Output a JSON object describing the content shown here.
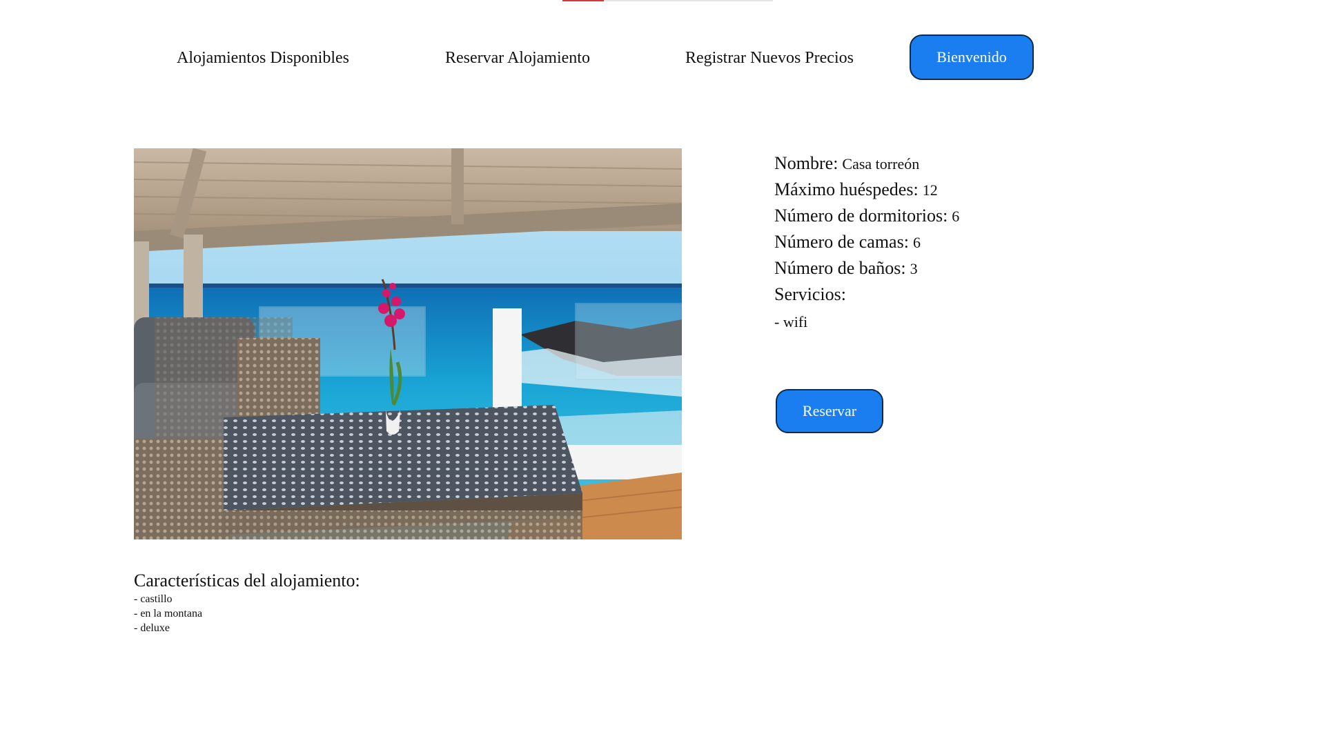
{
  "colors": {
    "primary_button": "#1a7ef0",
    "button_border": "#0b2a4a",
    "top_accent": "#d9343b"
  },
  "nav": {
    "links": [
      {
        "label": "Alojamientos Disponibles"
      },
      {
        "label": "Reservar Alojamiento"
      },
      {
        "label": "Registrar Nuevos Precios"
      }
    ],
    "welcome_button": "Bienvenido"
  },
  "property": {
    "image_icon": "terrace-sea-view-photo",
    "fields": [
      {
        "label": "Nombre:",
        "value": "Casa torreón"
      },
      {
        "label": "Máximo huéspedes:",
        "value": "12"
      },
      {
        "label": "Número de dormitorios:",
        "value": "6"
      },
      {
        "label": "Número de camas:",
        "value": "6"
      },
      {
        "label": "Número de baños:",
        "value": "3"
      }
    ],
    "services_label": "Servicios:",
    "services": [
      "- wifi"
    ],
    "reserve_button": "Reservar"
  },
  "features": {
    "title": "Características del alojamiento:",
    "items": [
      "- castillo",
      "- en la montana",
      "- deluxe"
    ]
  }
}
